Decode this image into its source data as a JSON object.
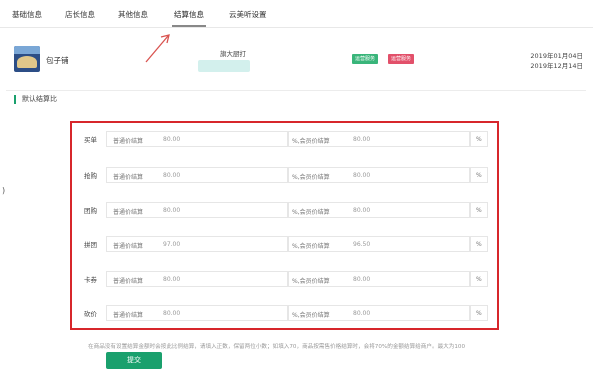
{
  "tabs": [
    "基础信息",
    "店长信息",
    "其他信息",
    "结算信息",
    "云美听设置"
  ],
  "store": {
    "name": "包子铺",
    "address": "旗大厨打",
    "badges": [
      "运营服务",
      "运营服务"
    ],
    "dates": [
      "2019年01月04日",
      "2019年12月14日"
    ]
  },
  "section": {
    "title": "默认结算比"
  },
  "side_mark": ")",
  "settlement": {
    "normal_caption": "普通价结算",
    "member_caption": "%,会员价结算",
    "unit": "%",
    "rows": [
      {
        "label": "买单",
        "normal": "80.00",
        "member": "80.00"
      },
      {
        "label": "抢购",
        "normal": "80.00",
        "member": "80.00"
      },
      {
        "label": "团购",
        "normal": "80.00",
        "member": "80.00"
      },
      {
        "label": "拼团",
        "normal": "97.00",
        "member": "96.50"
      },
      {
        "label": "卡券",
        "normal": "80.00",
        "member": "80.00"
      },
      {
        "label": "砍价",
        "normal": "80.00",
        "member": "80.00"
      }
    ]
  },
  "help_text": "在商品没有设置结算金额时会按此比例结算，请填入正数，保留两位小数；如填入70，商品按需售价格结算时，会将70%的金额结算给商户。最大为100",
  "submit_label": "提交",
  "colors": {
    "highlight_border": "#d7262b",
    "primary": "#1aa06d"
  }
}
